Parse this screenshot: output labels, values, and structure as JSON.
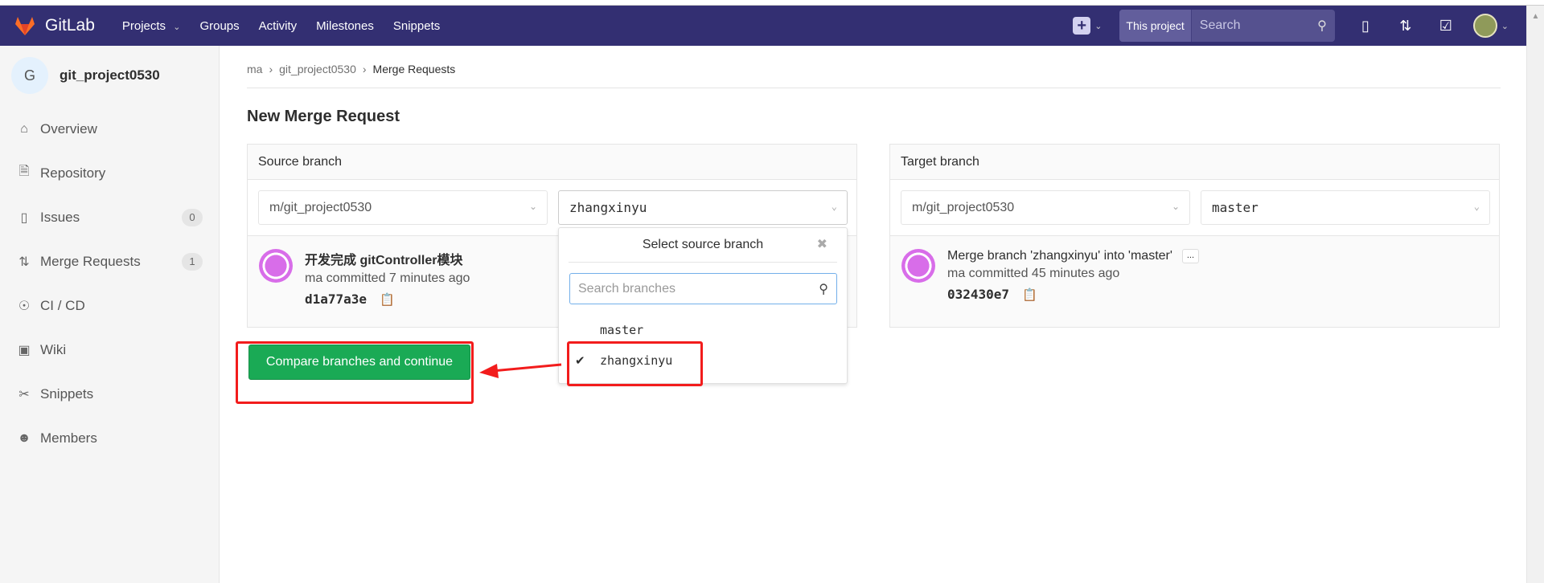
{
  "navbar": {
    "brand": "GitLab",
    "links": [
      "Projects",
      "Groups",
      "Activity",
      "Milestones",
      "Snippets"
    ],
    "search_scope": "This project",
    "search_placeholder": "Search",
    "color": "#332f72"
  },
  "sidebar": {
    "project_initial": "G",
    "project_name": "git_project0530",
    "items": [
      {
        "label": "Overview",
        "icon": "home-icon"
      },
      {
        "label": "Repository",
        "icon": "doc-icon"
      },
      {
        "label": "Issues",
        "icon": "issues-icon",
        "count": "0"
      },
      {
        "label": "Merge Requests",
        "icon": "merge-request-icon",
        "count": "1"
      },
      {
        "label": "CI / CD",
        "icon": "rocket-icon"
      },
      {
        "label": "Wiki",
        "icon": "book-icon"
      },
      {
        "label": "Snippets",
        "icon": "scissors-icon"
      },
      {
        "label": "Members",
        "icon": "users-icon"
      }
    ]
  },
  "breadcrumb": [
    "ma",
    "git_project0530",
    "Merge Requests"
  ],
  "page_title": "New Merge Request",
  "source": {
    "heading": "Source branch",
    "project": "m/git_project0530",
    "branch": "zhangxinyu",
    "commit_title": "开发完成 gitController模块",
    "commit_meta": "ma committed 7 minutes ago",
    "sha": "d1a77a3e"
  },
  "target": {
    "heading": "Target branch",
    "project": "m/git_project0530",
    "branch": "master",
    "commit_title": "Merge branch 'zhangxinyu' into 'master'",
    "ellipsis": "...",
    "commit_meta": "ma committed 45 minutes ago",
    "sha": "032430e7"
  },
  "dropdown": {
    "title": "Select source branch",
    "search_placeholder": "Search branches",
    "options": [
      "master",
      "zhangxinyu"
    ],
    "selected": "zhangxinyu"
  },
  "compare_button": "Compare branches and continue",
  "colors": {
    "primary_button": "#1aaa55",
    "annotation": "#f21c1c"
  }
}
